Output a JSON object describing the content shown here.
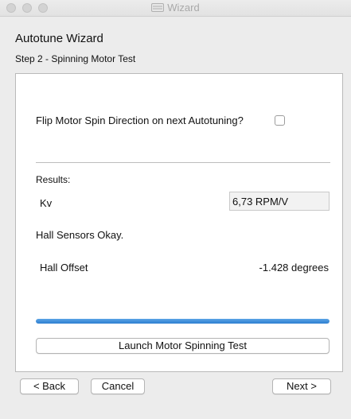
{
  "window": {
    "title": "Wizard"
  },
  "wizard": {
    "heading": "Autotune Wizard",
    "step": "Step 2 - Spinning Motor Test"
  },
  "panel": {
    "flip_label": "Flip Motor Spin Direction on next Autotuning?",
    "flip_checked": false,
    "results_label": "Results:",
    "kv_label": "Kv",
    "kv_value": "6,73 RPM/V",
    "hall_status": "Hall Sensors Okay.",
    "hall_offset_label": "Hall Offset",
    "hall_offset_value": "-1.428 degrees",
    "progress": 1.0,
    "launch_button": "Launch Motor Spinning Test"
  },
  "nav": {
    "back": "< Back",
    "cancel": "Cancel",
    "next": "Next >"
  },
  "colors": {
    "progress": "#2d7fd0"
  }
}
